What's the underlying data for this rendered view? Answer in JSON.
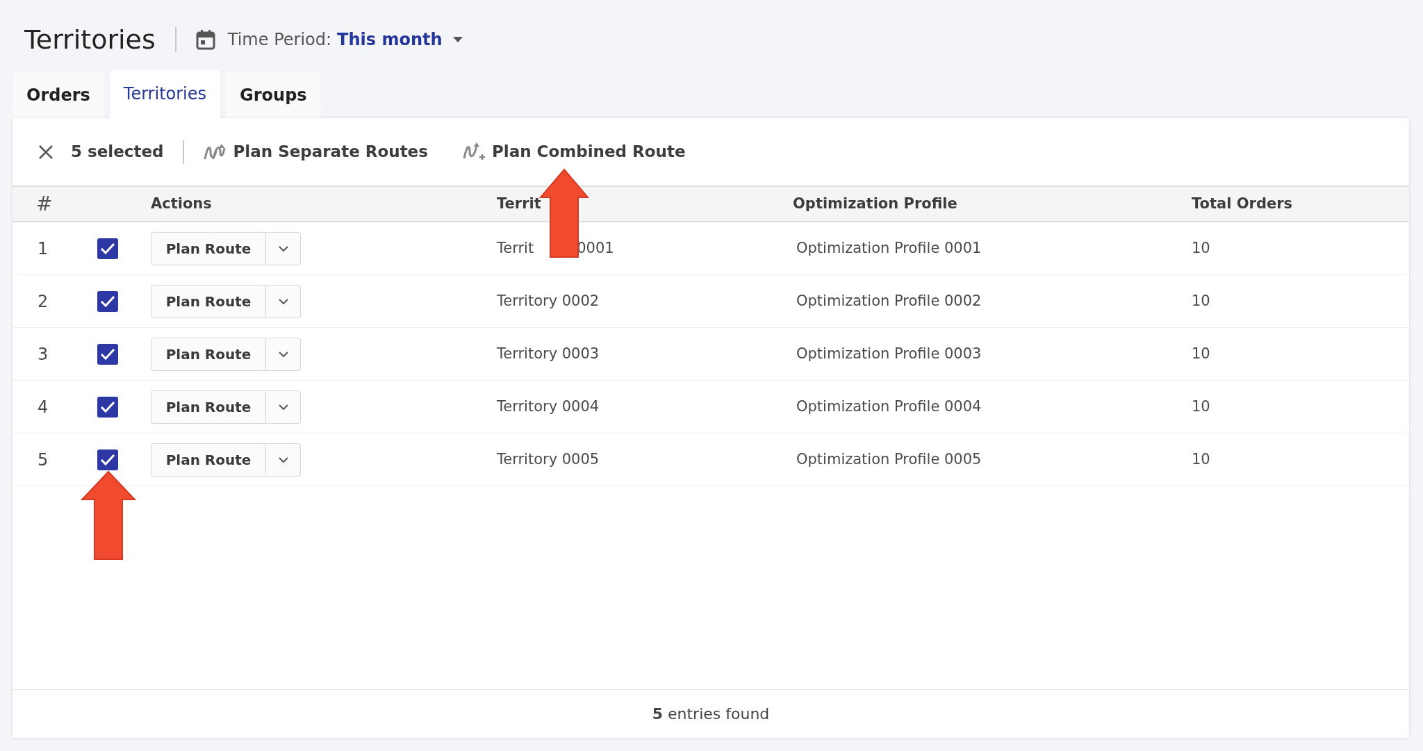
{
  "page_title": "Territories",
  "time_period": {
    "label": "Time Period:",
    "value": "This month"
  },
  "tabs": [
    {
      "label": "Orders",
      "selected": false
    },
    {
      "label": "Territories",
      "selected": true
    },
    {
      "label": "Groups",
      "selected": false
    }
  ],
  "selection_bar": {
    "count_text": "5 selected",
    "actions": [
      "Plan Separate Routes",
      "Plan Combined Route"
    ]
  },
  "table": {
    "columns": [
      "#",
      "Actions",
      "Territ",
      "Optimization Profile",
      "Total Orders"
    ],
    "rows": [
      {
        "number": "1",
        "checked": true,
        "action": "Plan Route",
        "territory": "Territ",
        "territory_tail": "0001",
        "profile": "Optimization Profile 0001",
        "total_orders": "10"
      },
      {
        "number": "2",
        "checked": true,
        "action": "Plan Route",
        "territory": "Territory 0002",
        "profile": "Optimization Profile 0002",
        "total_orders": "10"
      },
      {
        "number": "3",
        "checked": true,
        "action": "Plan Route",
        "territory": "Territory 0003",
        "profile": "Optimization Profile 0003",
        "total_orders": "10"
      },
      {
        "number": "4",
        "checked": true,
        "action": "Plan Route",
        "territory": "Territory 0004",
        "profile": "Optimization Profile 0004",
        "total_orders": "10"
      },
      {
        "number": "5",
        "checked": true,
        "action": "Plan Route",
        "territory": "Territory 0005",
        "profile": "Optimization Profile 0005",
        "total_orders": "10"
      }
    ]
  },
  "footer": "**5** entries found"
}
